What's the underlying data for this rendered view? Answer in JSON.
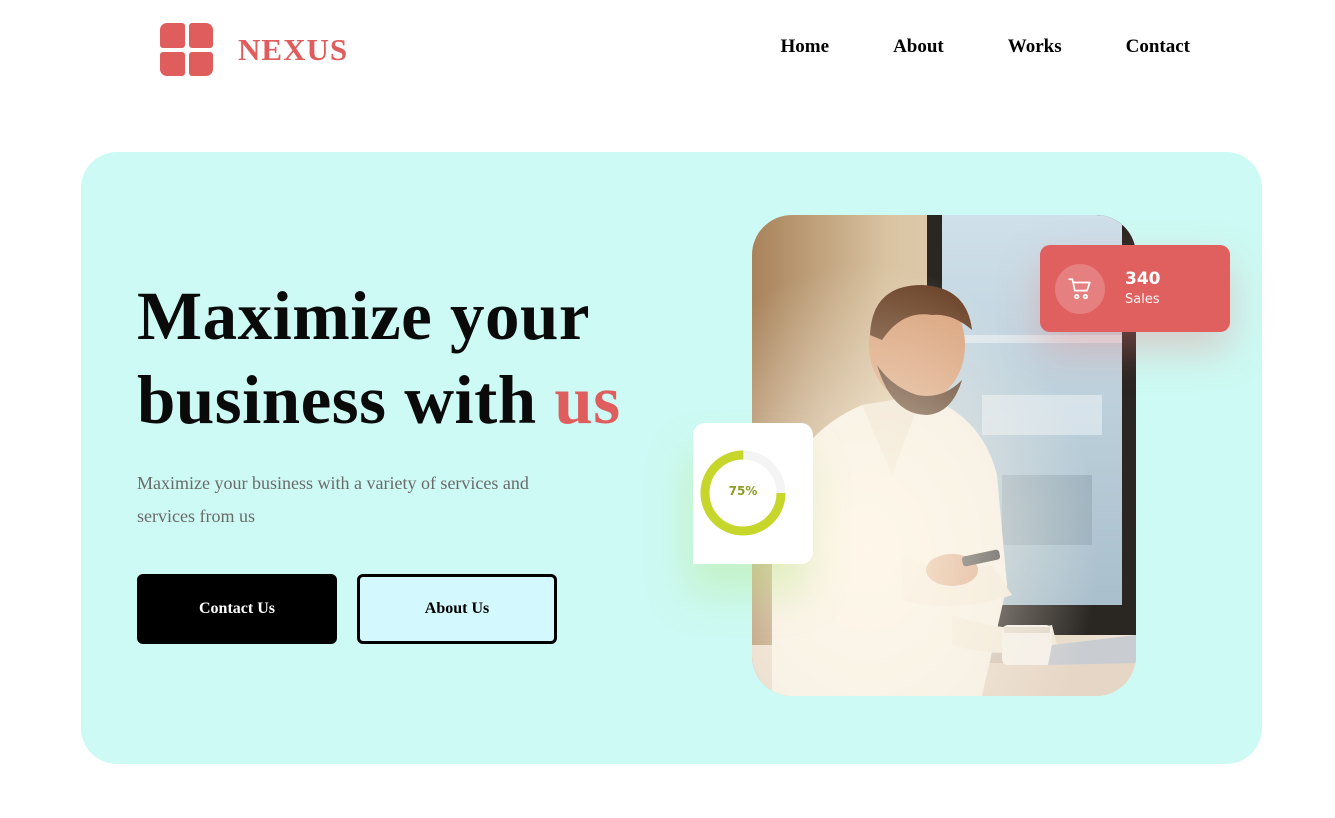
{
  "brand": {
    "name": "Nexus",
    "color": "#e05d5d"
  },
  "nav": [
    "Home",
    "About",
    "Works",
    "Contact"
  ],
  "hero": {
    "headline_line1": "Maximize your",
    "headline_line2_prefix": "business with ",
    "headline_line2_accent": "us",
    "subtext": "Maximize your business with a variety of services and services from us",
    "primary_button": "Contact Us",
    "secondary_button": "About Us",
    "background": "#cdfaf4"
  },
  "stats": {
    "sales_value": "340",
    "sales_label": "Sales",
    "sales_icon": "shopping-cart-icon",
    "progress_label": "75%",
    "progress_value": 0.75,
    "progress_color": "#c6d62a"
  },
  "image": {
    "subject": "photo of man at desk using phone"
  }
}
